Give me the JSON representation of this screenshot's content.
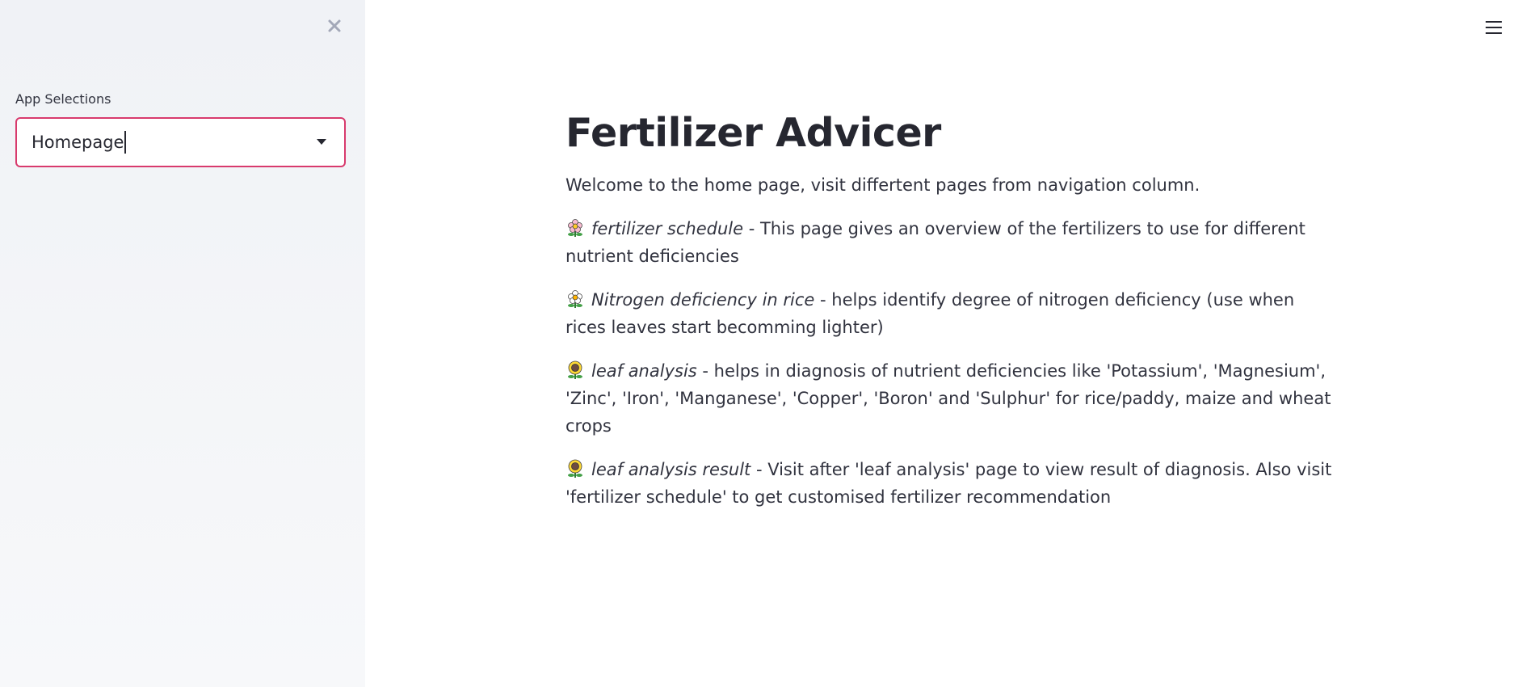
{
  "sidebar": {
    "label": "App Selections",
    "select_value": "Homepage"
  },
  "main": {
    "title": "Fertilizer Advicer",
    "intro": "Welcome to the home page, visit differtent pages from navigation column.",
    "items": [
      {
        "icon": "blossom-icon",
        "name": "fertilizer schedule",
        "text": " - This page gives an overview of the fertilizers to use for different nutrient deficiencies"
      },
      {
        "icon": "blossom-icon",
        "name": "Nitrogen deficiency in rice",
        "text": " - helps identify degree of nitrogen deficiency (use when rices leaves start becomming lighter)"
      },
      {
        "icon": "sunflower-icon",
        "name": "leaf analysis",
        "text": " - helps in diagnosis of nutrient deficiencies like 'Potassium', 'Magnesium', 'Zinc', 'Iron', 'Manganese', 'Copper', 'Boron' and 'Sulphur' for rice/paddy, maize and wheat crops"
      },
      {
        "icon": "sunflower-icon",
        "name": "leaf analysis result",
        "text": " - Visit after 'leaf analysis' page to view result of diagnosis. Also visit 'fertilizer schedule' to get customised fertilizer recommendation"
      }
    ]
  },
  "colors": {
    "accent": "#d83a6d",
    "sidebar_bg": "#f0f2f6",
    "text": "#262730"
  }
}
